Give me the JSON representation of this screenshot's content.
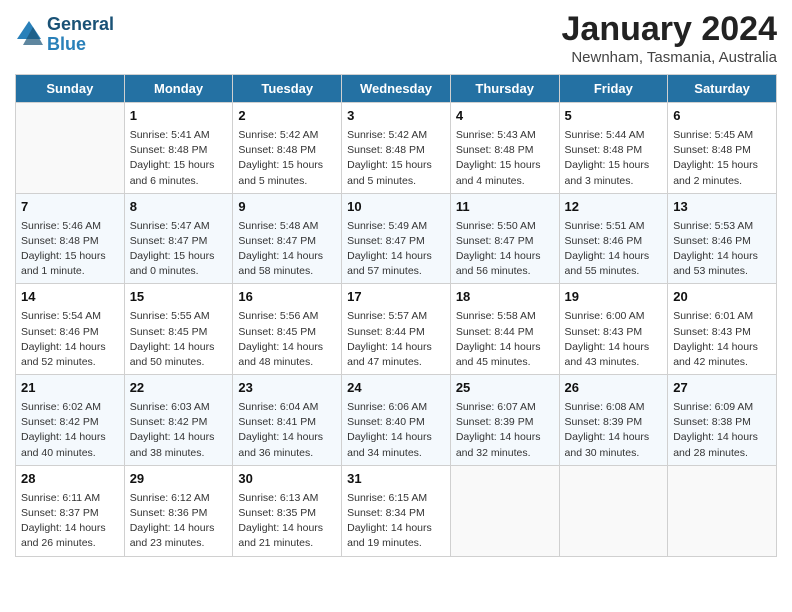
{
  "logo": {
    "line1": "General",
    "line2": "Blue"
  },
  "title": "January 2024",
  "location": "Newnham, Tasmania, Australia",
  "days_header": [
    "Sunday",
    "Monday",
    "Tuesday",
    "Wednesday",
    "Thursday",
    "Friday",
    "Saturday"
  ],
  "weeks": [
    [
      {
        "num": "",
        "lines": []
      },
      {
        "num": "1",
        "lines": [
          "Sunrise: 5:41 AM",
          "Sunset: 8:48 PM",
          "Daylight: 15 hours",
          "and 6 minutes."
        ]
      },
      {
        "num": "2",
        "lines": [
          "Sunrise: 5:42 AM",
          "Sunset: 8:48 PM",
          "Daylight: 15 hours",
          "and 5 minutes."
        ]
      },
      {
        "num": "3",
        "lines": [
          "Sunrise: 5:42 AM",
          "Sunset: 8:48 PM",
          "Daylight: 15 hours",
          "and 5 minutes."
        ]
      },
      {
        "num": "4",
        "lines": [
          "Sunrise: 5:43 AM",
          "Sunset: 8:48 PM",
          "Daylight: 15 hours",
          "and 4 minutes."
        ]
      },
      {
        "num": "5",
        "lines": [
          "Sunrise: 5:44 AM",
          "Sunset: 8:48 PM",
          "Daylight: 15 hours",
          "and 3 minutes."
        ]
      },
      {
        "num": "6",
        "lines": [
          "Sunrise: 5:45 AM",
          "Sunset: 8:48 PM",
          "Daylight: 15 hours",
          "and 2 minutes."
        ]
      }
    ],
    [
      {
        "num": "7",
        "lines": [
          "Sunrise: 5:46 AM",
          "Sunset: 8:48 PM",
          "Daylight: 15 hours",
          "and 1 minute."
        ]
      },
      {
        "num": "8",
        "lines": [
          "Sunrise: 5:47 AM",
          "Sunset: 8:47 PM",
          "Daylight: 15 hours",
          "and 0 minutes."
        ]
      },
      {
        "num": "9",
        "lines": [
          "Sunrise: 5:48 AM",
          "Sunset: 8:47 PM",
          "Daylight: 14 hours",
          "and 58 minutes."
        ]
      },
      {
        "num": "10",
        "lines": [
          "Sunrise: 5:49 AM",
          "Sunset: 8:47 PM",
          "Daylight: 14 hours",
          "and 57 minutes."
        ]
      },
      {
        "num": "11",
        "lines": [
          "Sunrise: 5:50 AM",
          "Sunset: 8:47 PM",
          "Daylight: 14 hours",
          "and 56 minutes."
        ]
      },
      {
        "num": "12",
        "lines": [
          "Sunrise: 5:51 AM",
          "Sunset: 8:46 PM",
          "Daylight: 14 hours",
          "and 55 minutes."
        ]
      },
      {
        "num": "13",
        "lines": [
          "Sunrise: 5:53 AM",
          "Sunset: 8:46 PM",
          "Daylight: 14 hours",
          "and 53 minutes."
        ]
      }
    ],
    [
      {
        "num": "14",
        "lines": [
          "Sunrise: 5:54 AM",
          "Sunset: 8:46 PM",
          "Daylight: 14 hours",
          "and 52 minutes."
        ]
      },
      {
        "num": "15",
        "lines": [
          "Sunrise: 5:55 AM",
          "Sunset: 8:45 PM",
          "Daylight: 14 hours",
          "and 50 minutes."
        ]
      },
      {
        "num": "16",
        "lines": [
          "Sunrise: 5:56 AM",
          "Sunset: 8:45 PM",
          "Daylight: 14 hours",
          "and 48 minutes."
        ]
      },
      {
        "num": "17",
        "lines": [
          "Sunrise: 5:57 AM",
          "Sunset: 8:44 PM",
          "Daylight: 14 hours",
          "and 47 minutes."
        ]
      },
      {
        "num": "18",
        "lines": [
          "Sunrise: 5:58 AM",
          "Sunset: 8:44 PM",
          "Daylight: 14 hours",
          "and 45 minutes."
        ]
      },
      {
        "num": "19",
        "lines": [
          "Sunrise: 6:00 AM",
          "Sunset: 8:43 PM",
          "Daylight: 14 hours",
          "and 43 minutes."
        ]
      },
      {
        "num": "20",
        "lines": [
          "Sunrise: 6:01 AM",
          "Sunset: 8:43 PM",
          "Daylight: 14 hours",
          "and 42 minutes."
        ]
      }
    ],
    [
      {
        "num": "21",
        "lines": [
          "Sunrise: 6:02 AM",
          "Sunset: 8:42 PM",
          "Daylight: 14 hours",
          "and 40 minutes."
        ]
      },
      {
        "num": "22",
        "lines": [
          "Sunrise: 6:03 AM",
          "Sunset: 8:42 PM",
          "Daylight: 14 hours",
          "and 38 minutes."
        ]
      },
      {
        "num": "23",
        "lines": [
          "Sunrise: 6:04 AM",
          "Sunset: 8:41 PM",
          "Daylight: 14 hours",
          "and 36 minutes."
        ]
      },
      {
        "num": "24",
        "lines": [
          "Sunrise: 6:06 AM",
          "Sunset: 8:40 PM",
          "Daylight: 14 hours",
          "and 34 minutes."
        ]
      },
      {
        "num": "25",
        "lines": [
          "Sunrise: 6:07 AM",
          "Sunset: 8:39 PM",
          "Daylight: 14 hours",
          "and 32 minutes."
        ]
      },
      {
        "num": "26",
        "lines": [
          "Sunrise: 6:08 AM",
          "Sunset: 8:39 PM",
          "Daylight: 14 hours",
          "and 30 minutes."
        ]
      },
      {
        "num": "27",
        "lines": [
          "Sunrise: 6:09 AM",
          "Sunset: 8:38 PM",
          "Daylight: 14 hours",
          "and 28 minutes."
        ]
      }
    ],
    [
      {
        "num": "28",
        "lines": [
          "Sunrise: 6:11 AM",
          "Sunset: 8:37 PM",
          "Daylight: 14 hours",
          "and 26 minutes."
        ]
      },
      {
        "num": "29",
        "lines": [
          "Sunrise: 6:12 AM",
          "Sunset: 8:36 PM",
          "Daylight: 14 hours",
          "and 23 minutes."
        ]
      },
      {
        "num": "30",
        "lines": [
          "Sunrise: 6:13 AM",
          "Sunset: 8:35 PM",
          "Daylight: 14 hours",
          "and 21 minutes."
        ]
      },
      {
        "num": "31",
        "lines": [
          "Sunrise: 6:15 AM",
          "Sunset: 8:34 PM",
          "Daylight: 14 hours",
          "and 19 minutes."
        ]
      },
      {
        "num": "",
        "lines": []
      },
      {
        "num": "",
        "lines": []
      },
      {
        "num": "",
        "lines": []
      }
    ]
  ]
}
